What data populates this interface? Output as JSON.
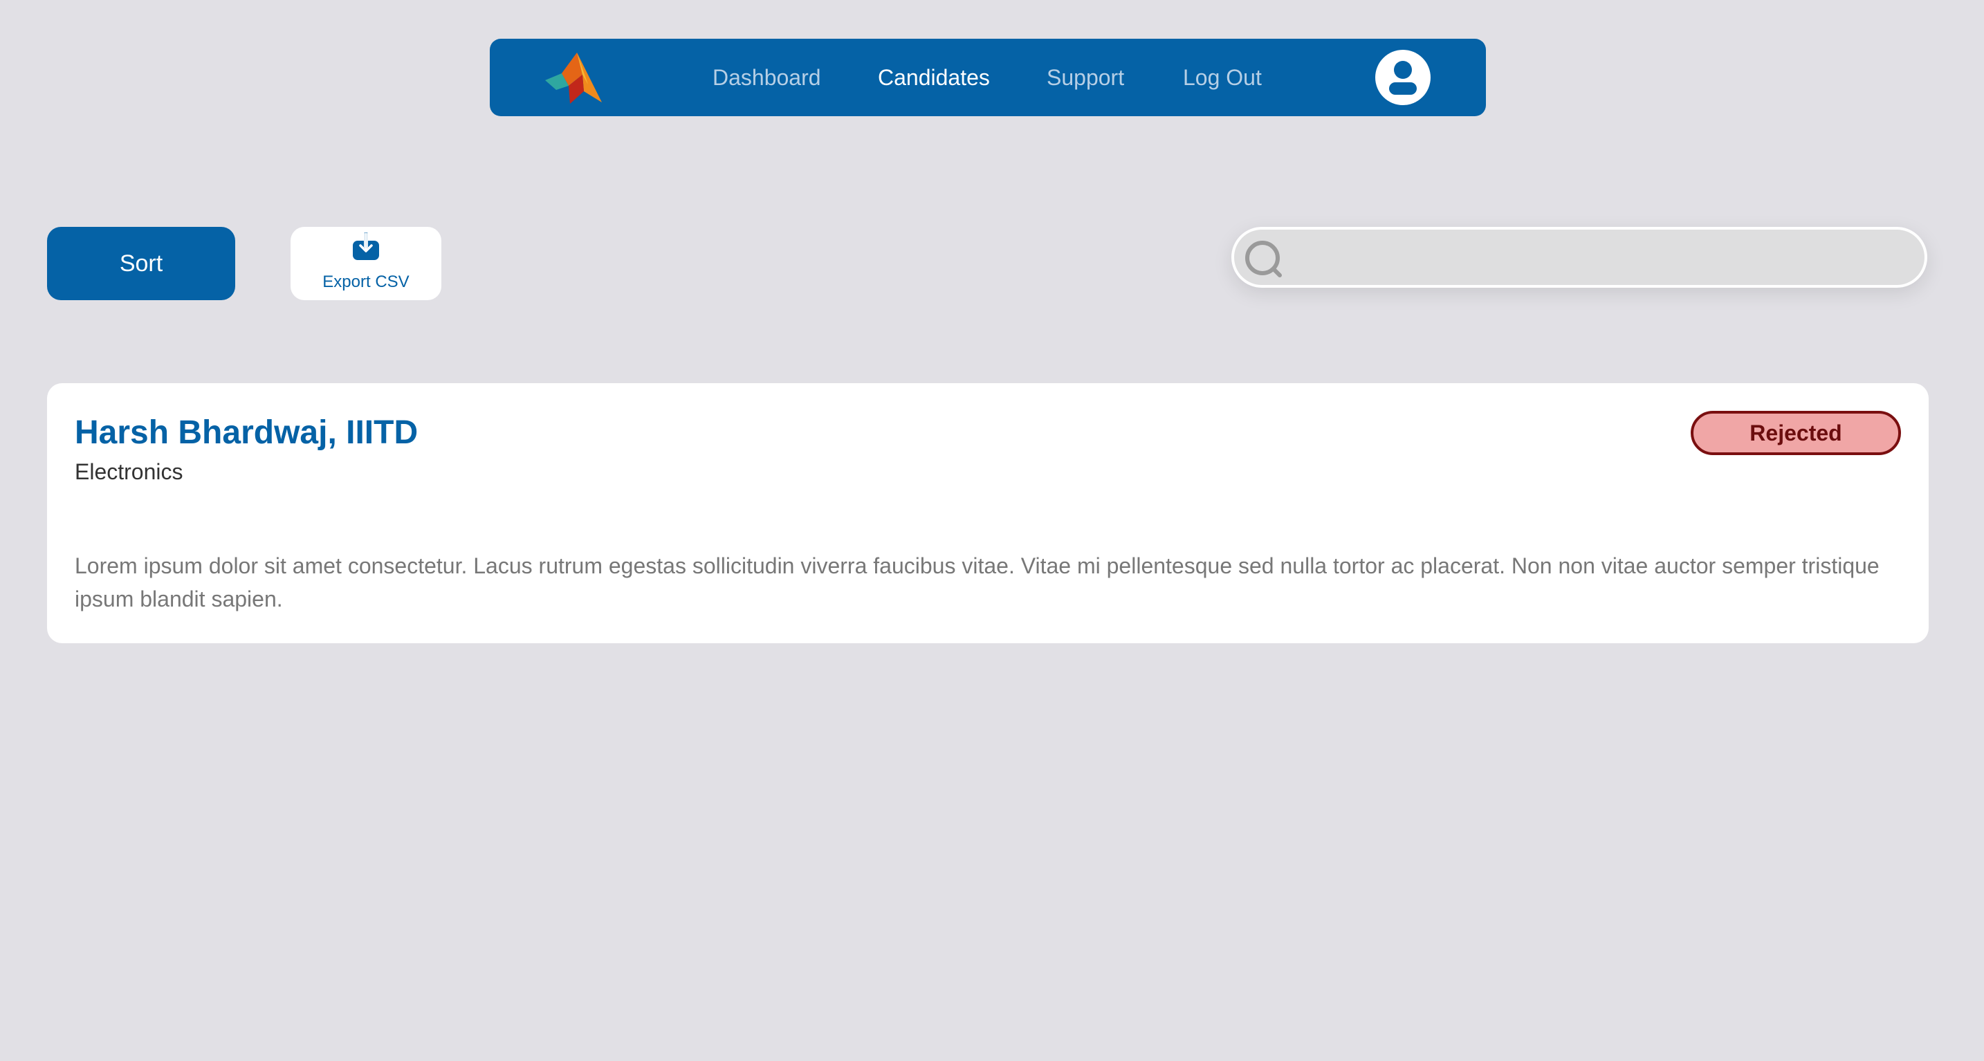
{
  "nav": {
    "logo_icon": "matlab-logo-icon",
    "links": [
      {
        "label": "Dashboard",
        "active": false
      },
      {
        "label": "Candidates",
        "active": true
      },
      {
        "label": "Support",
        "active": false
      },
      {
        "label": "Log Out",
        "active": false
      }
    ],
    "avatar_icon": "user-avatar-icon",
    "color_bg": "#0562a6",
    "color_active": "#ffffff",
    "color_inactive": "#b6cfe6"
  },
  "toolbar": {
    "sort_label": "Sort",
    "export_label": "Export CSV",
    "export_icon": "download-icon"
  },
  "search": {
    "placeholder": "",
    "value": "",
    "icon": "search-icon"
  },
  "candidates": [
    {
      "name": "Harsh Bhardwaj, IIITD",
      "department": "Electronics",
      "status": "Rejected",
      "status_color": "#f0a6a6",
      "description": "Lorem ipsum dolor sit amet consectetur. Lacus rutrum egestas sollicitudin viverra faucibus vitae. Vitae mi pellentesque sed nulla tortor ac placerat. Non non vitae auctor semper tristique ipsum blandit sapien."
    }
  ]
}
